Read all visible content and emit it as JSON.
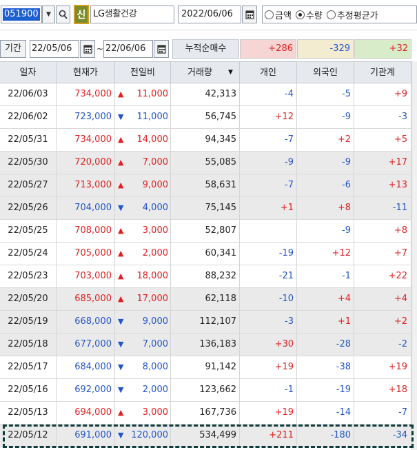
{
  "toolbar": {
    "stock_code": "051900",
    "new_badge": "신",
    "stock_name": "LG생활건강",
    "date": "2022/06/06",
    "radio_options": [
      {
        "label": "금액",
        "selected": false
      },
      {
        "label": "수량",
        "selected": true
      },
      {
        "label": "추정평균가",
        "selected": false
      }
    ]
  },
  "period": {
    "label": "기간",
    "from": "22/05/06",
    "tilde": "~",
    "to": "22/06/06"
  },
  "cumulative": {
    "label": "누적순매수",
    "individual": "+286",
    "foreign": "-329",
    "institution": "+32"
  },
  "table": {
    "headers": {
      "date": "일자",
      "price": "현재가",
      "change": "전일비",
      "volume": "거래량",
      "individual": "개인",
      "foreign": "외국인",
      "institution": "기관계"
    },
    "rows": [
      {
        "date": "22/06/03",
        "price": "734,000",
        "dir": "up",
        "change": "11,000",
        "volume": "42,313",
        "individual": "-4",
        "foreign": "-5",
        "institution": "+9",
        "shaded": false
      },
      {
        "date": "22/06/02",
        "price": "723,000",
        "dir": "down",
        "change": "11,000",
        "volume": "56,745",
        "individual": "+12",
        "foreign": "-9",
        "institution": "-3",
        "shaded": false
      },
      {
        "date": "22/05/31",
        "price": "734,000",
        "dir": "up",
        "change": "14,000",
        "volume": "94,345",
        "individual": "-7",
        "foreign": "+2",
        "institution": "+5",
        "shaded": false
      },
      {
        "date": "22/05/30",
        "price": "720,000",
        "dir": "up",
        "change": "7,000",
        "volume": "55,085",
        "individual": "-9",
        "foreign": "-9",
        "institution": "+17",
        "shaded": true
      },
      {
        "date": "22/05/27",
        "price": "713,000",
        "dir": "up",
        "change": "9,000",
        "volume": "58,631",
        "individual": "-7",
        "foreign": "-6",
        "institution": "+13",
        "shaded": true
      },
      {
        "date": "22/05/26",
        "price": "704,000",
        "dir": "down",
        "change": "4,000",
        "volume": "75,145",
        "individual": "+1",
        "foreign": "+8",
        "institution": "-11",
        "shaded": true
      },
      {
        "date": "22/05/25",
        "price": "708,000",
        "dir": "up",
        "change": "3,000",
        "volume": "52,807",
        "individual": "",
        "foreign": "-9",
        "institution": "+8",
        "shaded": false
      },
      {
        "date": "22/05/24",
        "price": "705,000",
        "dir": "up",
        "change": "2,000",
        "volume": "60,341",
        "individual": "-19",
        "foreign": "+12",
        "institution": "+7",
        "shaded": false
      },
      {
        "date": "22/05/23",
        "price": "703,000",
        "dir": "up",
        "change": "18,000",
        "volume": "88,232",
        "individual": "-21",
        "foreign": "-1",
        "institution": "+22",
        "shaded": false
      },
      {
        "date": "22/05/20",
        "price": "685,000",
        "dir": "up",
        "change": "17,000",
        "volume": "62,118",
        "individual": "-10",
        "foreign": "+4",
        "institution": "+4",
        "shaded": true
      },
      {
        "date": "22/05/19",
        "price": "668,000",
        "dir": "down",
        "change": "9,000",
        "volume": "112,107",
        "individual": "-3",
        "foreign": "+1",
        "institution": "+2",
        "shaded": true
      },
      {
        "date": "22/05/18",
        "price": "677,000",
        "dir": "down",
        "change": "7,000",
        "volume": "136,183",
        "individual": "+30",
        "foreign": "-28",
        "institution": "-2",
        "shaded": true
      },
      {
        "date": "22/05/17",
        "price": "684,000",
        "dir": "down",
        "change": "8,000",
        "volume": "91,142",
        "individual": "+19",
        "foreign": "-38",
        "institution": "+19",
        "shaded": false
      },
      {
        "date": "22/05/16",
        "price": "692,000",
        "dir": "down",
        "change": "2,000",
        "volume": "123,662",
        "individual": "-1",
        "foreign": "-19",
        "institution": "+18",
        "shaded": false
      },
      {
        "date": "22/05/13",
        "price": "694,000",
        "dir": "up",
        "change": "3,000",
        "volume": "167,736",
        "individual": "+19",
        "foreign": "-14",
        "institution": "-7",
        "shaded": false
      },
      {
        "date": "22/05/12",
        "price": "691,000",
        "dir": "down",
        "change": "120,000",
        "volume": "534,499",
        "individual": "+211",
        "foreign": "-180",
        "institution": "-34",
        "shaded": true
      }
    ]
  },
  "colors": {
    "up": "#e02020",
    "down": "#2255c8",
    "selection": "#1c5fd1",
    "badge": "#7a8c2a"
  },
  "icons": {
    "up_arrow": "▲",
    "down_arrow": "▼",
    "dropdown": "▼",
    "sort": "▼"
  }
}
